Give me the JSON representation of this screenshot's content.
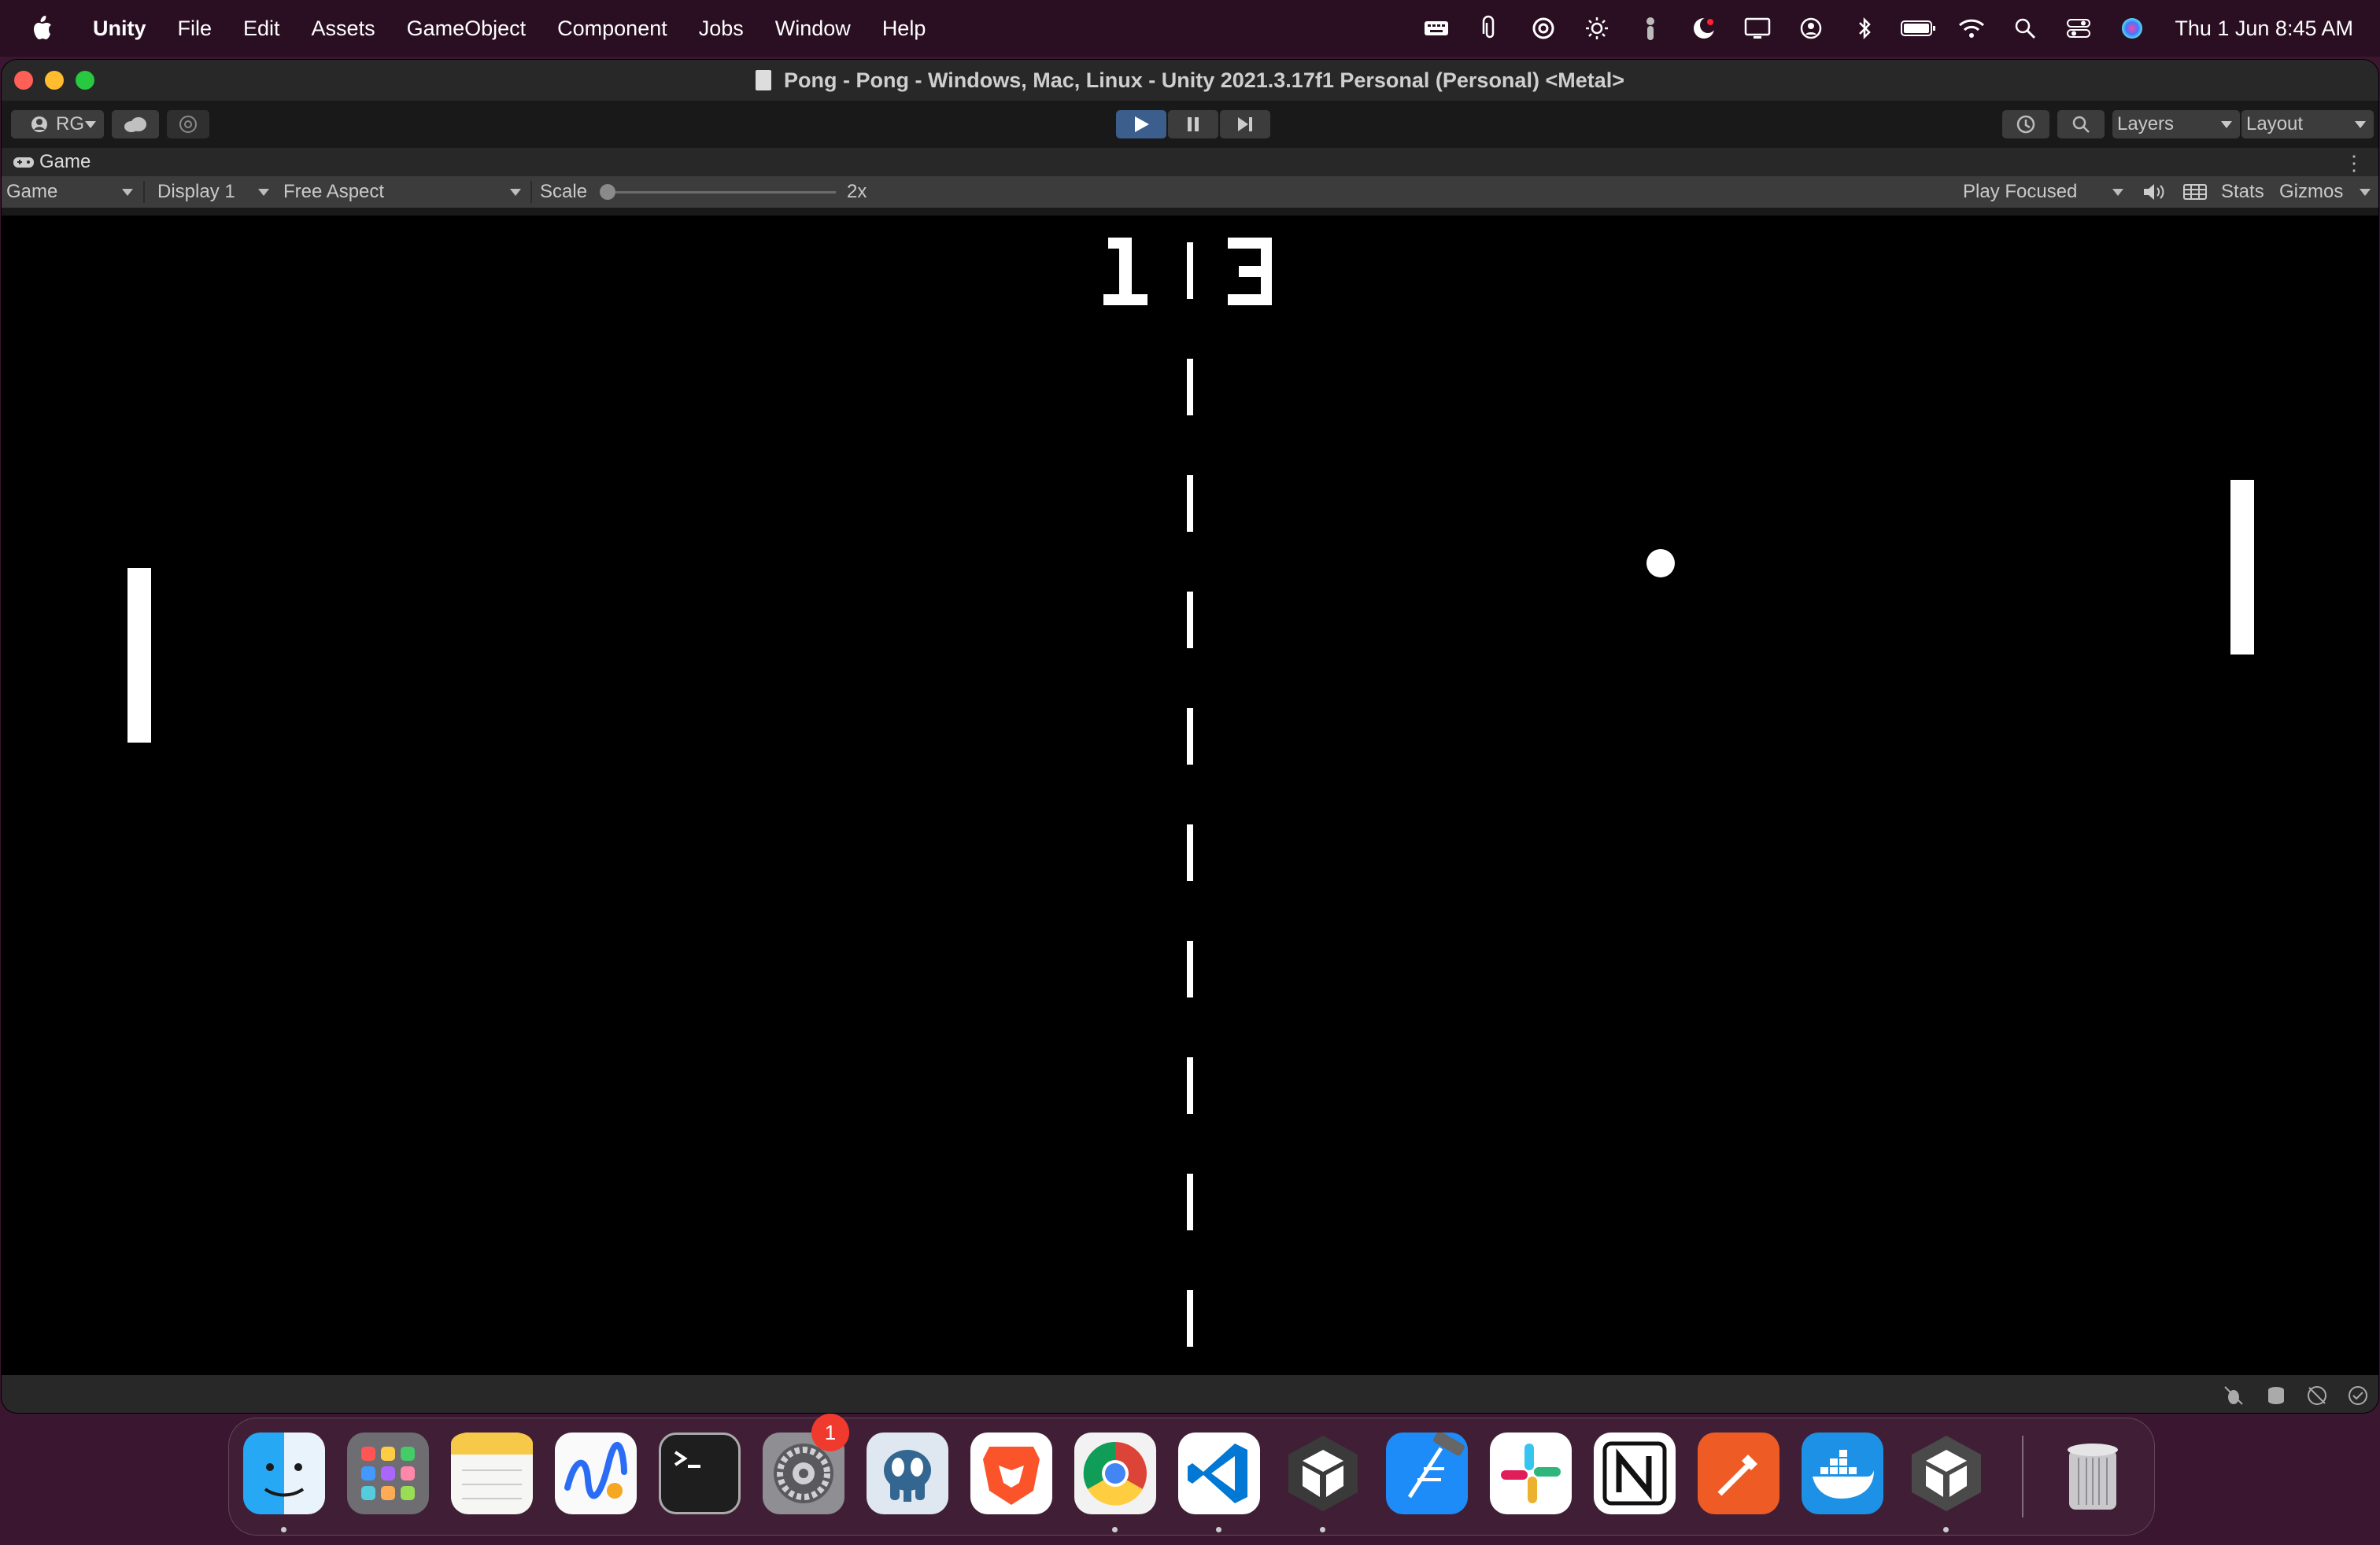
{
  "menubar": {
    "app_name": "Unity",
    "items": [
      "File",
      "Edit",
      "Assets",
      "GameObject",
      "Component",
      "Jobs",
      "Window",
      "Help"
    ],
    "clock": "Thu 1 Jun  8:45 AM",
    "status_icons": [
      "keyboard-icon",
      "paperclip-icon",
      "at-icon",
      "brightness-icon",
      "ghost-icon",
      "moon-icon",
      "display-icon",
      "user-circle-icon",
      "bluetooth-icon",
      "battery-icon",
      "wifi-icon",
      "spotlight-icon",
      "control-center-icon",
      "siri-icon"
    ]
  },
  "window": {
    "title": "Pong - Pong - Windows, Mac, Linux - Unity 2021.3.17f1 Personal (Personal) <Metal>"
  },
  "toolbar": {
    "account_label": "RG",
    "layers_label": "Layers",
    "layout_label": "Layout"
  },
  "game_tab": {
    "label": "Game"
  },
  "game_bar": {
    "view_mode": "Game",
    "display": "Display 1",
    "aspect": "Free Aspect",
    "scale_label": "Scale",
    "scale_value": "2x",
    "play_mode": "Play Focused",
    "stats_label": "Stats",
    "gizmos_label": "Gizmos"
  },
  "game": {
    "score_left": "1",
    "score_right": "3"
  },
  "dock": {
    "apps": [
      "finder",
      "launchpad",
      "notes",
      "freeform",
      "terminal",
      "system-settings",
      "pgadmin",
      "brave",
      "chrome",
      "vscode",
      "unity-hub",
      "xcode",
      "slack",
      "notion",
      "postman",
      "docker",
      "unity",
      "trash"
    ],
    "settings_badge": "1"
  },
  "colors": {
    "accent_play": "#3c5e8c",
    "game_bg": "#000000",
    "game_fg": "#ffffff"
  }
}
